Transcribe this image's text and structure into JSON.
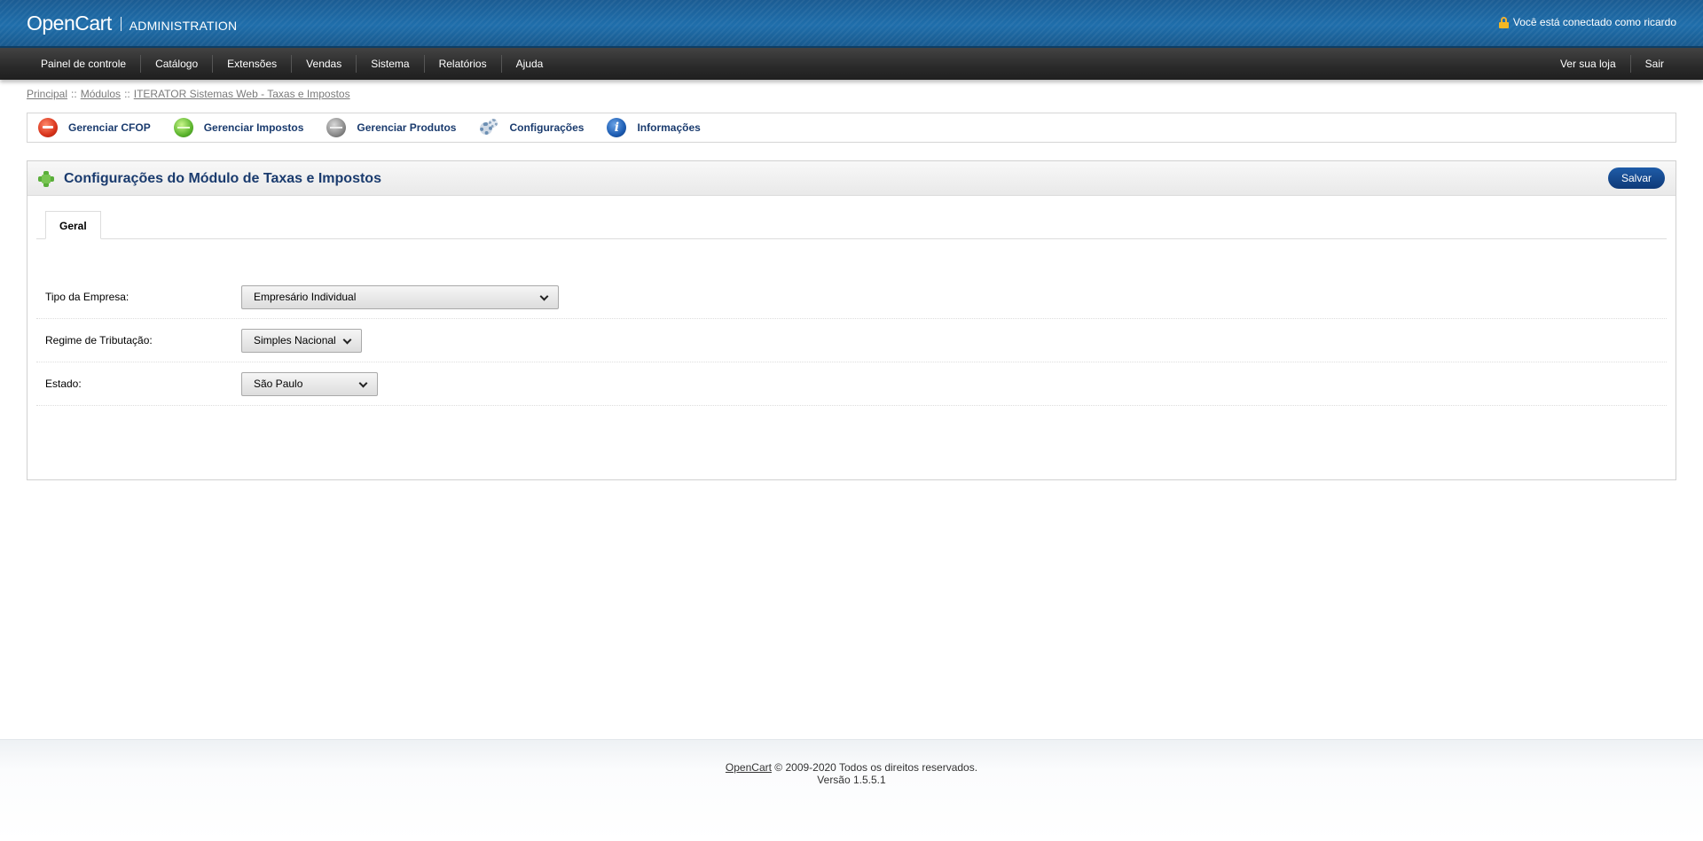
{
  "header": {
    "brand": "OpenCart",
    "subtitle": "ADMINISTRATION",
    "login_text": "Você está conectado como ricardo"
  },
  "menu": {
    "left": [
      {
        "label": "Painel de controle"
      },
      {
        "label": "Catálogo"
      },
      {
        "label": "Extensões"
      },
      {
        "label": "Vendas"
      },
      {
        "label": "Sistema"
      },
      {
        "label": "Relatórios"
      },
      {
        "label": "Ajuda"
      }
    ],
    "right": [
      {
        "label": "Ver sua loja"
      },
      {
        "label": "Sair"
      }
    ]
  },
  "breadcrumb": {
    "items": [
      "Principal",
      "Módulos",
      "ITERATOR Sistemas Web - Taxas e Impostos"
    ],
    "separator": "::"
  },
  "toolbar": {
    "items": [
      {
        "label": "Gerenciar CFOP",
        "icon": "red-minus-icon"
      },
      {
        "label": "Gerenciar Impostos",
        "icon": "green-orb-icon"
      },
      {
        "label": "Gerenciar Produtos",
        "icon": "gray-orb-icon"
      },
      {
        "label": "Configurações",
        "icon": "gears-icon"
      },
      {
        "label": "Informações",
        "icon": "info-icon"
      }
    ]
  },
  "panel": {
    "title": "Configurações do Módulo de Taxas e Impostos",
    "save_label": "Salvar",
    "tabs": [
      {
        "label": "Geral"
      }
    ]
  },
  "form": {
    "tipo_empresa": {
      "label": "Tipo da Empresa:",
      "value": "Empresário Individual"
    },
    "regime": {
      "label": "Regime de Tributação:",
      "value": "Simples Nacional"
    },
    "estado": {
      "label": "Estado:",
      "value": "São Paulo"
    }
  },
  "footer": {
    "link": "OpenCart",
    "copyright": "© 2009-2020 Todos os direitos reservados.",
    "version": "Versão 1.5.5.1"
  },
  "colors": {
    "header_blue": "#1f6eab",
    "menu_dark": "#2a2a2a",
    "accent_navy": "#1a3b6e",
    "save_button": "#1f5ca8"
  }
}
